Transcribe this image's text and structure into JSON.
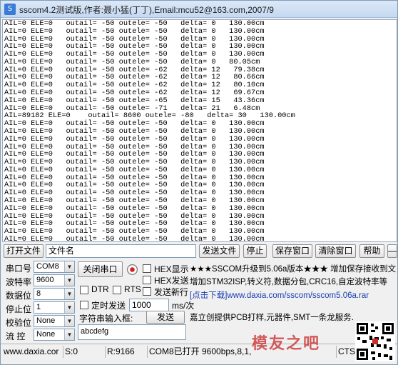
{
  "window": {
    "title": "sscom4.2测试版,作者:聂小猛(丁丁),Email:mcu52@163.com,2007/9",
    "app_icon_text": "S"
  },
  "receive": {
    "lines": [
      "AIL=0 ELE=0   outail= -50 outele= -50   delta= 0   130.00cm",
      "AIL=0 ELE=0   outail= -50 outele= -50   delta= 0   130.00cm",
      "AIL=0 ELE=0   outail= -50 outele= -50   delta= 0   130.00cm",
      "AIL=0 ELE=0   outail= -50 outele= -50   delta= 0   130.00cm",
      "AIL=0 ELE=0   outail= -50 outele= -50   delta= 0   130.00cm",
      "AIL=0 ELE=0   outail= -50 outele= -50   delta= 0   80.05cm",
      "AIL=0 ELE=0   outail= -50 outele= -62   delta= 12   79.38cm",
      "AIL=0 ELE=0   outail= -50 outele= -62   delta= 12   80.66cm",
      "AIL=0 ELE=0   outail= -50 outele= -62   delta= 12   80.10cm",
      "AIL=0 ELE=0   outail= -50 outele= -62   delta= 12   69.67cm",
      "AIL=0 ELE=0   outail= -50 outele= -65   delta= 15   43.36cm",
      "AIL=0 ELE=0   outail= -50 outele= -71   delta= 21   6.48cm",
      "AIL=89182 ELE=0    outail= 8600 outele= -80   delta= 30   130.00cm",
      "AIL=0 ELE=0   outail= -50 outele= -50   delta= 0   130.00cm",
      "AIL=0 ELE=0   outail= -50 outele= -50   delta= 0   130.00cm",
      "AIL=0 ELE=0   outail= -50 outele= -50   delta= 0   130.00cm",
      "AIL=0 ELE=0   outail= -50 outele= -50   delta= 0   130.00cm",
      "AIL=0 ELE=0   outail= -50 outele= -50   delta= 0   130.00cm",
      "AIL=0 ELE=0   outail= -50 outele= -50   delta= 0   130.00cm",
      "AIL=0 ELE=0   outail= -50 outele= -50   delta= 0   130.00cm",
      "AIL=0 ELE=0   outail= -50 outele= -50   delta= 0   130.00cm",
      "AIL=0 ELE=0   outail= -50 outele= -50   delta= 0   130.00cm",
      "AIL=0 ELE=0   outail= -50 outele= -50   delta= 0   130.00cm",
      "AIL=0 ELE=0   outail= -50 outele= -50   delta= 0   130.00cm",
      "AIL=0 ELE=0   outail= -50 outele= -50   delta= 0   130.00cm",
      "AIL=0 ELE=0   outail= -50 outele= -50   delta= 0   130.00cm",
      "AIL=0 ELE=0   outail= -50 outele= -50   delta= 0   130.00cm",
      "AIL=0 ELE=0   outail= -50 outele= -50   delta= 0   130.00cm",
      "AIL=0 ELE=0   outail= -50 outele= -50   delta= 0   130.00cm"
    ]
  },
  "toolbar": {
    "open_file": "打开文件",
    "filename": "文件名",
    "send_file": "发送文件",
    "stop": "停止",
    "save_window": "保存窗口",
    "clear_window": "清除窗口",
    "help": "帮助",
    "collapse": "—"
  },
  "settings": {
    "port_label": "串口号",
    "port_value": "COM8",
    "baud_label": "波特率",
    "baud_value": "9600",
    "databits_label": "数据位",
    "databits_value": "8",
    "stopbits_label": "停止位",
    "stopbits_value": "1",
    "parity_label": "校验位",
    "parity_value": "None",
    "flow_label": "流 控",
    "flow_value": "None",
    "dropdown_arrow": "▼"
  },
  "controls": {
    "close_port": "关闭串口",
    "hex_display": "HEX显示",
    "hex_send": "HEX发送",
    "send_newline": "发送新行",
    "dtr": "DTR",
    "rts": "RTS",
    "timed_send": "定时发送",
    "interval_value": "1000",
    "interval_unit": "ms/次",
    "input_label": "字符串输入框:",
    "send": "发送",
    "input_value": "abcdefg"
  },
  "ad": {
    "line1": "★★★SSCOM升级到5.06a版本★★★ 增加保存接收到文",
    "line2": "增加STM32ISP,转义符,数据分包,CRC16,自定波特率等",
    "line3_prefix": "[点击下载]",
    "line3_link": "www.daxia.com/sscom/sscom5.06a.rar",
    "line4": "嘉立创提供PCB打样,元器件,SMT一条龙服务."
  },
  "statusbar": {
    "site": "www.daxia.cor",
    "sent": "S:0",
    "received": "R:9166",
    "port_state": "COM8已打开  9600bps,8,1,",
    "cts": "CTS"
  },
  "watermark": "模友之吧"
}
